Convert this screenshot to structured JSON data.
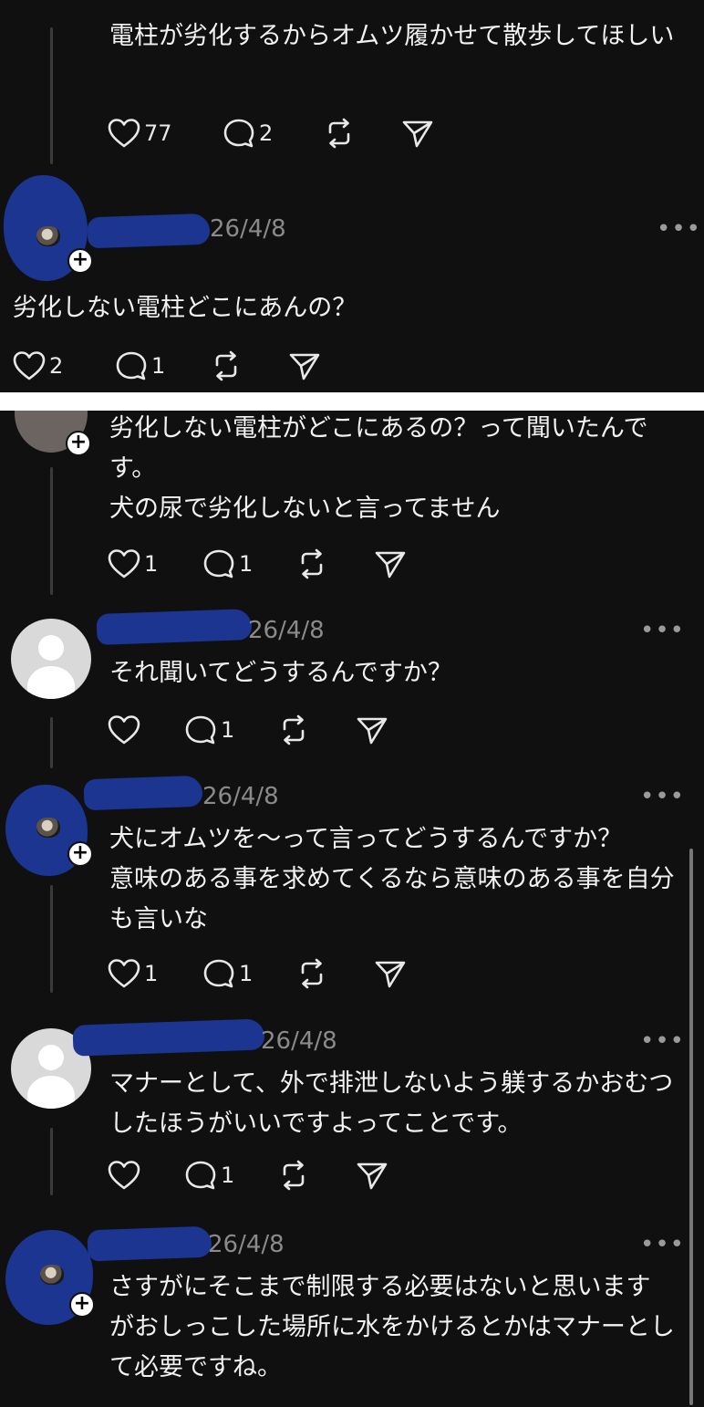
{
  "top": {
    "post1": {
      "text": "電柱が劣化するからオムツ履かせて散歩してほしい",
      "likes": "77",
      "replies": "2"
    },
    "post2": {
      "date": "26/4/8",
      "more": "•••",
      "text": "劣化しない電柱どこにあんの？",
      "likes": "2",
      "replies": "1"
    }
  },
  "bottom": {
    "post1": {
      "text_line1": "劣化しない電柱がどこにあるの？って聞いたんです。",
      "text_line2": "犬の尿で劣化しないと言ってません",
      "likes": "1",
      "replies": "1"
    },
    "post2": {
      "date": "26/4/8",
      "more": "•••",
      "text": "それ聞いてどうするんですか？",
      "likes": "",
      "replies": "1"
    },
    "post3": {
      "date": "26/4/8",
      "more": "•••",
      "text_line1": "犬にオムツを〜って言ってどうするんですか？",
      "text_line2": "意味のある事を求めてくるなら意味のある事を自分も言いな",
      "likes": "1",
      "replies": "1"
    },
    "post4": {
      "date": "26/4/8",
      "more": "•••",
      "text": "マナーとして、外で排泄しないよう躾するかおむつしたほうがいいですよってことです。",
      "likes": "",
      "replies": "1"
    },
    "post5": {
      "date": "26/4/8",
      "more": "•••",
      "text": "さすがにそこまで制限する必要はないと思いますがおしっこした場所に水をかけるとかはマナーとして必要ですね。"
    }
  },
  "colors": {
    "background": "#101010",
    "text": "#f2f2f2",
    "muted": "#8a8a8a",
    "redaction": "#1b3591"
  },
  "icons": [
    "heart-icon",
    "comment-icon",
    "repost-icon",
    "share-icon",
    "more-icon",
    "plus-icon"
  ]
}
